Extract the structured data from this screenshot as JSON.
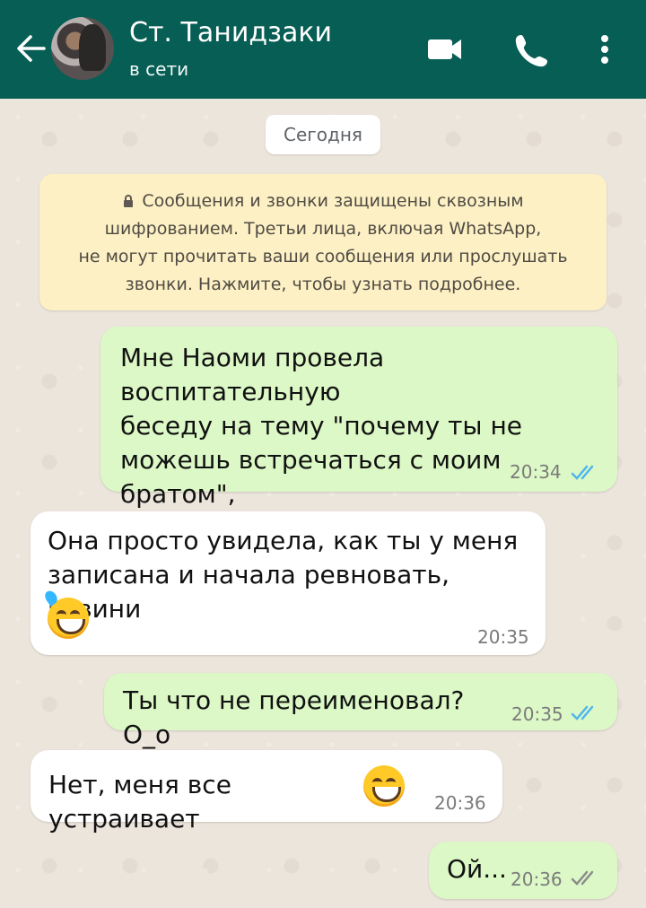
{
  "header": {
    "title": "Ст. Танидзаки",
    "status": "в сети",
    "icons": [
      "back-arrow-icon",
      "video-call-icon",
      "phone-icon",
      "more-vertical-icon"
    ]
  },
  "chat": {
    "date": "Сегодня",
    "notice": {
      "lines": [
        "Сообщения и звонки защищены сквозным",
        "шифрованием. Третьи лица, включая WhatsApp,",
        "не могут прочитать ваши сообщения или прослушать",
        "звонки. Нажмите, чтобы узнать подробнее."
      ]
    },
    "messages": [
      {
        "direction": "out",
        "text": "Мне Наоми провела воспитательную\nбеседу на тему \"почему ты не\nможешь встречаться с моим братом\",\nмне не понравилось",
        "time": "20:34",
        "status": "read"
      },
      {
        "direction": "in",
        "text": "Она просто увидела, как ты у меня\nзаписана и начала ревновать, извини",
        "time": "20:35",
        "emoji": "grinning-sweat-emoji"
      },
      {
        "direction": "out",
        "text": "Ты что не переименовал? О_о",
        "time": "20:35",
        "status": "read"
      },
      {
        "direction": "in",
        "text": "Нет, меня все устраивает",
        "time": "20:36",
        "emoji": "grinning-emoji"
      },
      {
        "direction": "out",
        "text": "Ой...",
        "time": "20:36",
        "status": "delivered"
      }
    ]
  },
  "colors": {
    "header": "#075e54",
    "chat_background": "#ece5dc",
    "outgoing_bubble": "#dcf8c6",
    "incoming_bubble": "#ffffff",
    "notice_background": "#fdf0c4",
    "read_ticks": "#4fb6ec",
    "delivered_ticks": "#8b8b8b"
  }
}
